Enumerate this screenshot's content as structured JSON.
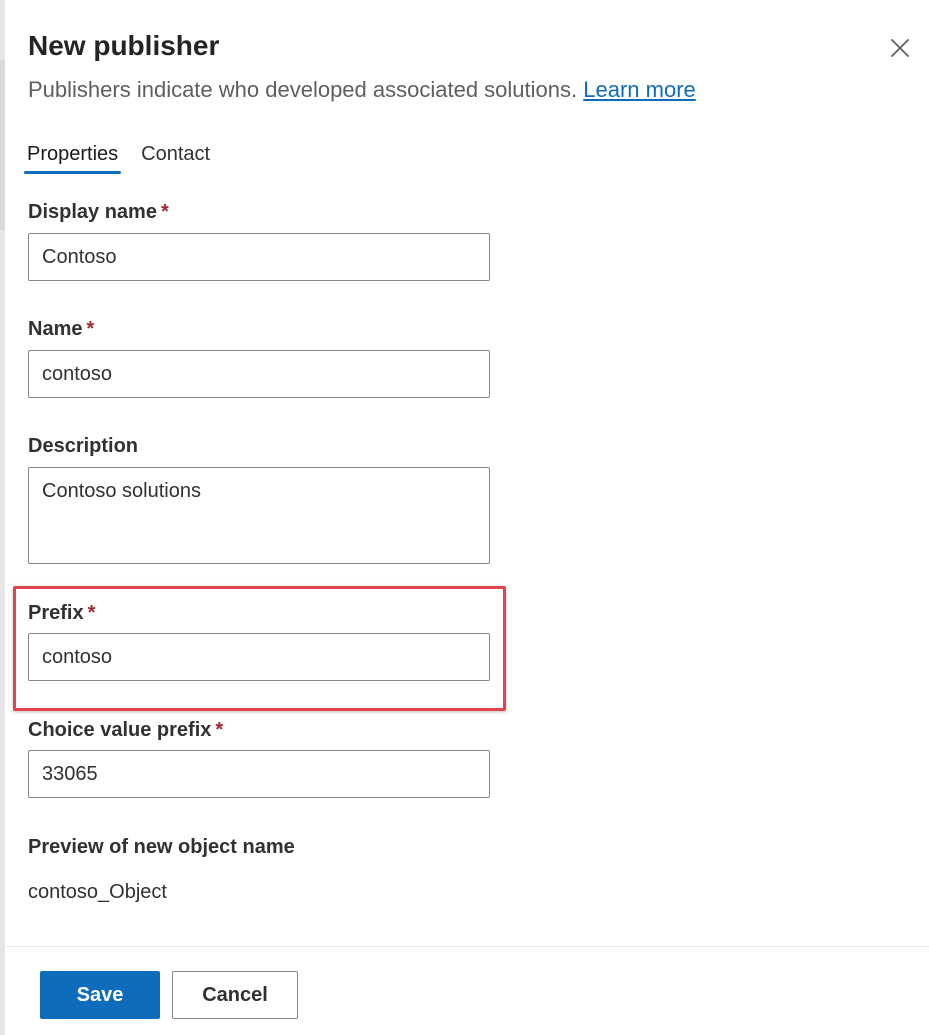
{
  "dialog": {
    "title": "New publisher",
    "subtitle": "Publishers indicate who developed associated solutions.",
    "learn_more": "Learn more"
  },
  "tabs": [
    {
      "label": "Properties",
      "active": true
    },
    {
      "label": "Contact",
      "active": false
    }
  ],
  "fields": {
    "display_name": {
      "label": "Display name",
      "required": "*",
      "value": "Contoso"
    },
    "name": {
      "label": "Name",
      "required": "*",
      "value": "contoso"
    },
    "description": {
      "label": "Description",
      "value": "Contoso solutions"
    },
    "prefix": {
      "label": "Prefix",
      "required": "*",
      "value": "contoso"
    },
    "choice_value_prefix": {
      "label": "Choice value prefix",
      "required": "*",
      "value": "33065"
    }
  },
  "preview": {
    "label": "Preview of new object name",
    "value": "contoso_Object"
  },
  "footer": {
    "save_label": "Save",
    "cancel_label": "Cancel"
  },
  "colors": {
    "accent": "#0f6cbd",
    "required": "#a4262c",
    "highlight": "#e0454c"
  },
  "icons": {
    "close": "close-icon"
  }
}
